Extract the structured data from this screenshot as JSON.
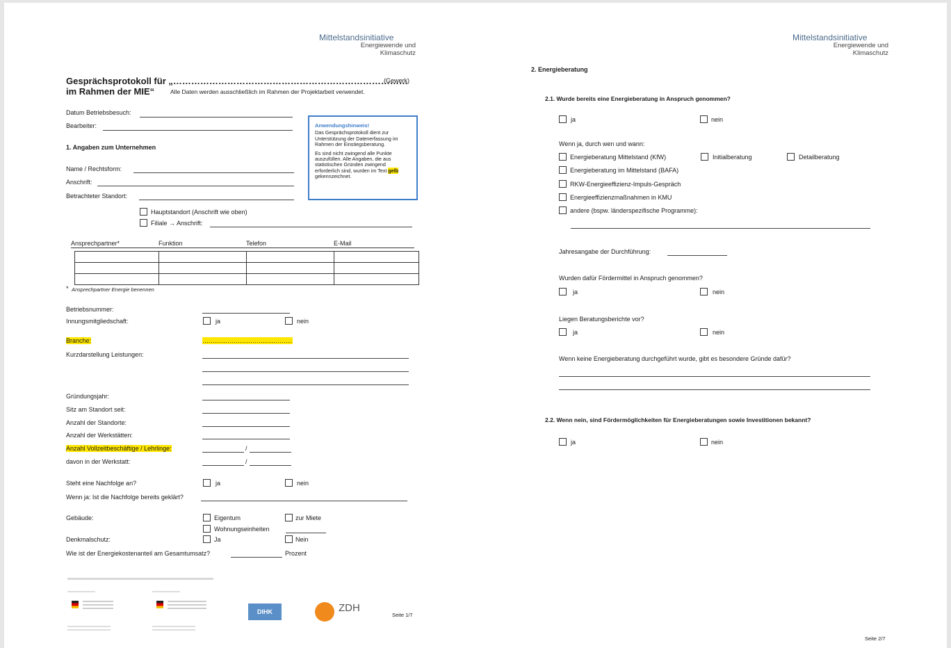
{
  "page1": {
    "brand": {
      "line1": "Mittelstandsinitiative",
      "line2": "Energiewende und",
      "line3": "Klimaschutz"
    },
    "title_line1": "Gesprächsprotokoll für „……………………………………………………………………",
    "title_suffix": "(Gewerk)",
    "title_line2": "im Rahmen der MIE“",
    "title_note": "Alle Daten werden ausschließlich im Rahmen der Projektarbeit verwendet.",
    "datum_label": "Datum Betriebsbesuch:",
    "bearbeiter_label": "Bearbeiter:",
    "note": {
      "title": "Anwendungshinweis!",
      "p1": "Das Gesprächsprotokoll dient zur Unterstützung der Datenerfassung im Rahmen der Einstiegsberatung.",
      "p2a": "Es sind nicht zwingend alle Punkte auszufüllen. Alle Angaben, die aus statistischen Gründen zwingend erforderlich sind, wurden im Text",
      "p2b": "gelb",
      "p2c": "gekennzeichnet."
    },
    "section1": "1.  Angaben zum Unternehmen",
    "name_label": "Name / Rechtsform:",
    "anschrift_label": "Anschrift:",
    "standort_label": "Betrachteter Standort:",
    "hauptstandort": "Hauptstandort (Anschrift wie oben)",
    "filiale": "Filiale → Anschrift:",
    "table_headers": [
      "Ansprechpartner*",
      "Funktion",
      "Telefon",
      "E-Mail"
    ],
    "footnote_star": "*",
    "footnote": "Ansprechpartner Energie benennen",
    "betriebsnummer": "Betriebsnummer:",
    "innung": "Innungsmitgliedschaft:",
    "ja": "ja",
    "nein": "nein",
    "branche": "Branche:",
    "branche_dots": "…………………………………………",
    "kurzdarstellung": "Kurzdarstellung Leistungen:",
    "gruendungsjahr": "Gründungsjahr:",
    "sitz": "Sitz am Standort seit:",
    "anzahl_standorte": "Anzahl der Standorte:",
    "anzahl_werkstaetten": "Anzahl der Werkstätten:",
    "vollzeit": "Anzahl Vollzeitbeschäftige / Lehrlinge:",
    "slash": "/",
    "davon": "davon in der Werkstatt:",
    "nachfolge": "Steht eine Nachfolge an?",
    "nachfolge_geklaert": "Wenn ja: Ist die Nachfolge bereits geklärt?",
    "gebaeude": "Gebäude:",
    "eigentum": "Eigentum",
    "miete": "zur Miete",
    "wohnung": "Wohnungseinheiten",
    "denkmal": "Denkmalschutz:",
    "Ja": "Ja",
    "Nein": "Nein",
    "energiekosten": "Wie ist der Energiekostenanteil am Gesamtumsatz?",
    "prozent": "Prozent",
    "logo_dihk": "DIHK",
    "logo_zdh": "ZDH",
    "page_no": "Seite 1/7"
  },
  "page2": {
    "section2": "2.   Energieberatung",
    "q21": "2.1.  Wurde bereits eine Energieberatung in Anspruch genommen?",
    "ja": "ja",
    "nein": "nein",
    "wenn_ja": "Wenn ja, durch wen und wann:",
    "opt_kfw": "Energieberatung Mittelstand (KfW)",
    "opt_initial": "Initialberatung",
    "opt_detail": "Detailberatung",
    "opt_bafa": "Energieberatung im Mittelstand (BAFA)",
    "opt_rkw": "RKW-Energieeffizienz-Impuls-Gespräch",
    "opt_kmu": "Energieeffizienzmaßnahmen in KMU",
    "opt_andere": "andere (bspw. länderspezifische Programme):",
    "jahresangabe": "Jahresangabe der Durchführung:",
    "foerdermittel": "Wurden dafür Fördermittel in Anspruch genommen?",
    "berichte": "Liegen Beratungsberichte vor?",
    "gruende": "Wenn keine Energieberatung durchgeführt wurde, gibt es besondere Gründe dafür?",
    "q22": "2.2.  Wenn nein, sind Fördermöglichkeiten für Energieberatungen sowie Investitionen bekannt?",
    "page_no": "Seite 2/7"
  }
}
